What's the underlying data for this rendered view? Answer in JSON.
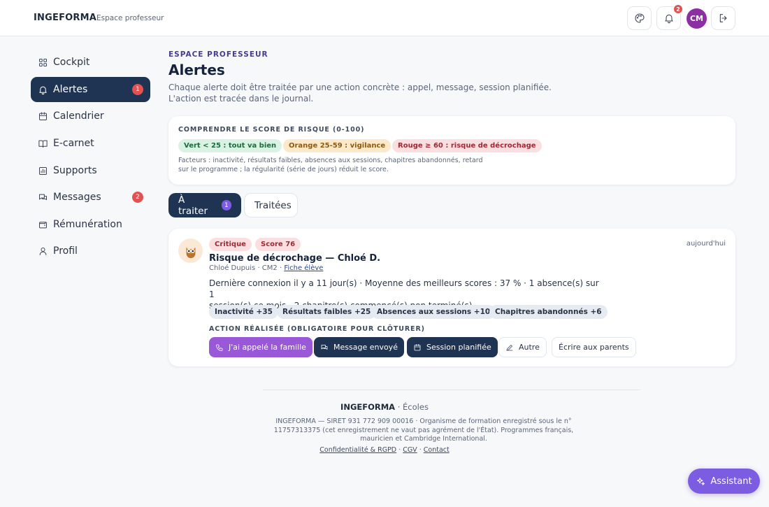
{
  "header": {
    "brand": "INGEFORMA",
    "subtitle": "Espace professeur",
    "notification_count": "2",
    "avatar_initials": "CM"
  },
  "sidebar": {
    "items": [
      {
        "label": "Cockpit",
        "icon": "grid-icon"
      },
      {
        "label": "Alertes",
        "icon": "bell-icon",
        "badge": "1",
        "active": true
      },
      {
        "label": "Calendrier",
        "icon": "calendar-icon"
      },
      {
        "label": "E-carnet",
        "icon": "book-icon"
      },
      {
        "label": "Supports",
        "icon": "chart-icon"
      },
      {
        "label": "Messages",
        "icon": "messages-icon",
        "badge": "2"
      },
      {
        "label": "Rémunération",
        "icon": "wallet-icon"
      },
      {
        "label": "Profil",
        "icon": "user-icon"
      }
    ]
  },
  "main": {
    "eyebrow": "ESPACE PROFESSEUR",
    "title": "Alertes",
    "description_line1": "Chaque alerte doit être traitée par une action concrète : appel, message, session planifiée.",
    "description_line2": "L'action est tracée dans le journal."
  },
  "risk": {
    "title": "COMPRENDRE LE SCORE DE RISQUE (0-100)",
    "levels": [
      "Vert < 25 : tout va bien",
      "Orange 25-59 : vigilance",
      "Rouge ≥ 60 : risque de décrochage"
    ],
    "factors_line1": "Facteurs : inactivité, résultats faibles, absences aux sessions, chapitres abandonnés, retard",
    "factors_line2": "sur le programme ; la régularité (série de jours) réduit le score."
  },
  "tabs": [
    {
      "label": "À traiter",
      "count": "1"
    },
    {
      "label": "Traitées"
    }
  ],
  "alert": {
    "severity": "Critique",
    "score": "Score 76",
    "date": "aujourd'hui",
    "title": "Risque de décrochage — Chloé D.",
    "student": "Chloé Dupuis · CM2 · ",
    "student_link": "Fiche élève",
    "body_line1": "Dernière connexion il y a 11 jour(s) · Moyenne des meilleurs scores : 37 % · 1 absence(s) sur 1",
    "body_line2": "session(s) ce mois · 2 chapitre(s) commencé(s) non terminé(s)",
    "factors": [
      "Inactivité +35",
      "Résultats faibles +25",
      "Absences aux sessions +10",
      "Chapitres abandonnés +6"
    ],
    "action_title": "ACTION RÉALISÉE (OBLIGATOIRE POUR CLÔTURER)",
    "actions": [
      "J'ai appelé la famille",
      "Message envoyé",
      "Session planifiée",
      "Autre",
      "Écrire aux parents"
    ]
  },
  "footer": {
    "brand": "INGEFORMA",
    "brand_suffix": " · Écoles",
    "legal": "INGEFORMA — SIRET 931 772 909 00016 · Organisme de formation enregistré sous le n° 11757313375 (cet enregistrement ne vaut pas agrément de l'État). Programmes français, mauricien et Cambridge International.",
    "links": [
      "Confidentialité & RGPD",
      "CGV",
      "Contact"
    ]
  },
  "assistant": {
    "label": "Assistant"
  }
}
